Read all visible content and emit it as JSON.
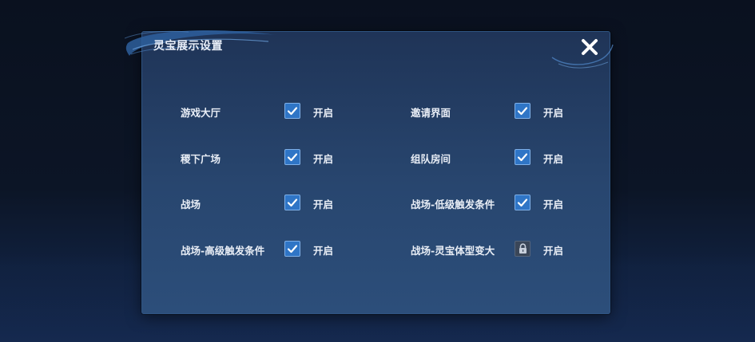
{
  "dialog": {
    "title": "灵宝展示设置",
    "close_icon": "close-icon"
  },
  "options": [
    {
      "label": "游戏大厅",
      "state": "开启",
      "checked": true,
      "locked": false
    },
    {
      "label": "邀请界面",
      "state": "开启",
      "checked": true,
      "locked": false
    },
    {
      "label": "稷下广场",
      "state": "开启",
      "checked": true,
      "locked": false
    },
    {
      "label": "组队房间",
      "state": "开启",
      "checked": true,
      "locked": false
    },
    {
      "label": "战场",
      "state": "开启",
      "checked": true,
      "locked": false
    },
    {
      "label": "战场-低级触发条件",
      "state": "开启",
      "checked": true,
      "locked": false
    },
    {
      "label": "战场-高级触发条件",
      "state": "开启",
      "checked": true,
      "locked": false
    },
    {
      "label": "战场-灵宝体型变大",
      "state": "开启",
      "checked": false,
      "locked": true
    }
  ],
  "colors": {
    "panel": "#28466f",
    "checkbox_fill": "#2f75c6",
    "text": "#e9eef6"
  }
}
